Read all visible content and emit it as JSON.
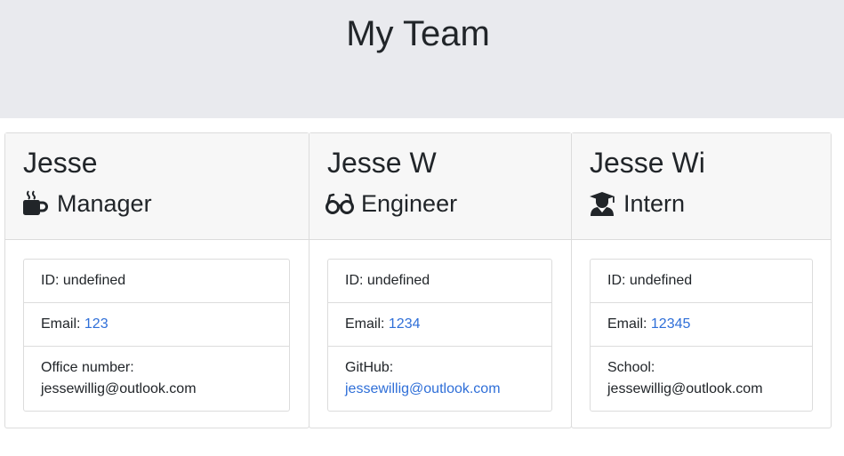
{
  "header": {
    "title": "My Team"
  },
  "cards": [
    {
      "name": "Jesse",
      "role": "Manager",
      "role_icon": "coffee-icon",
      "id_label": "ID: ",
      "id_value": "undefined",
      "email_label": "Email: ",
      "email_value": "123",
      "extra_label": "Office number:",
      "extra_value": "jessewillig@outlook.com"
    },
    {
      "name": "Jesse W",
      "role": "Engineer",
      "role_icon": "glasses-icon",
      "id_label": "ID: ",
      "id_value": "undefined",
      "email_label": "Email: ",
      "email_value": "1234",
      "extra_label": "GitHub:",
      "extra_value": "jessewillig@outlook.com"
    },
    {
      "name": "Jesse Wi",
      "role": "Intern",
      "role_icon": "graduate-icon",
      "id_label": "ID: ",
      "id_value": "undefined",
      "email_label": "Email: ",
      "email_value": "12345",
      "extra_label": "School:",
      "extra_value": "jessewillig@outlook.com"
    }
  ],
  "colors": {
    "link": "#2f6fd8",
    "jumbotron": "#e9eaee",
    "card_header": "#f7f7f7"
  }
}
